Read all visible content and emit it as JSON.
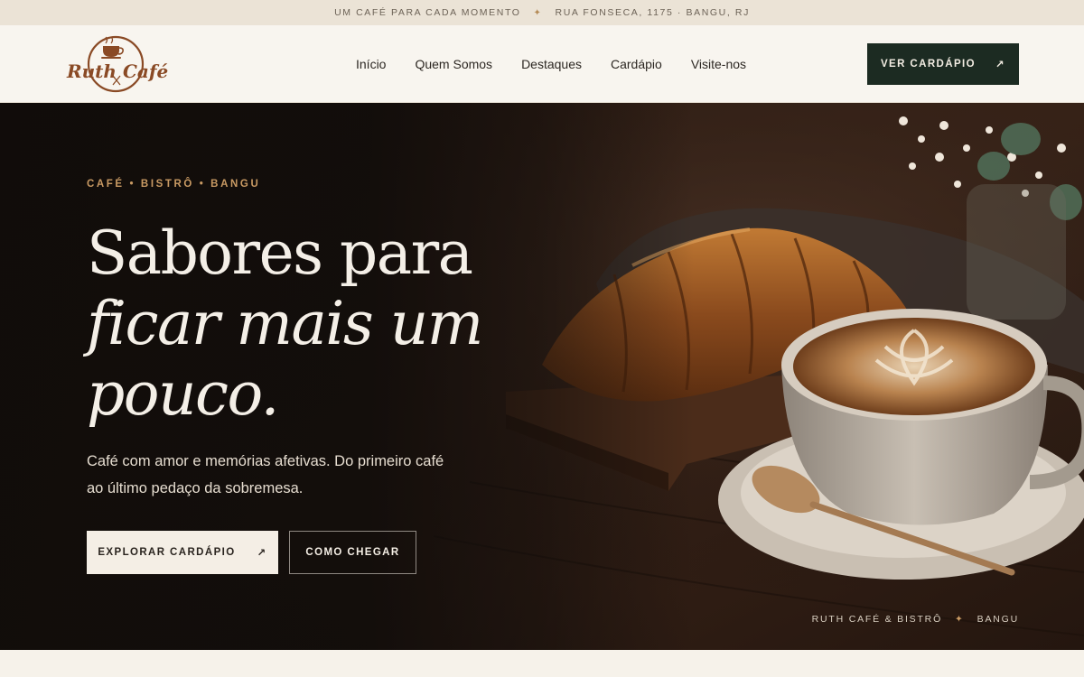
{
  "announcement": {
    "left": "UM CAFÉ PARA CADA MOMENTO",
    "separator": "✦",
    "right": "RUA FONSECA, 1175 · BANGU, RJ"
  },
  "brand": {
    "name_left": "Ruth",
    "name_right": "Café",
    "logo_icon": "coffee-cup-icon",
    "color": "#8a4a25"
  },
  "nav": {
    "items": [
      {
        "label": "Início"
      },
      {
        "label": "Quem Somos"
      },
      {
        "label": "Destaques"
      },
      {
        "label": "Cardápio"
      },
      {
        "label": "Visite-nos"
      }
    ],
    "cta_label": "VER CARDÁPIO",
    "cta_icon": "↗",
    "cta_color": "#1c2b22"
  },
  "hero": {
    "eyebrow": "CAFÉ • BISTRÔ • BANGU",
    "headline_line1": "Sabores para",
    "headline_line2": "ficar mais um",
    "headline_line3": "pouco.",
    "subtitle": "Café com amor e memórias afetivas. Do primeiro café ao último pedaço da sobremesa.",
    "primary_button": "EXPLORAR CARDÁPIO",
    "primary_icon": "↗",
    "secondary_button": "COMO CHEGAR",
    "footer_left": "RUTH CAFÉ & BISTRÔ",
    "footer_separator": "✦",
    "footer_right": "BANGU",
    "accent_color": "#c99a63"
  }
}
